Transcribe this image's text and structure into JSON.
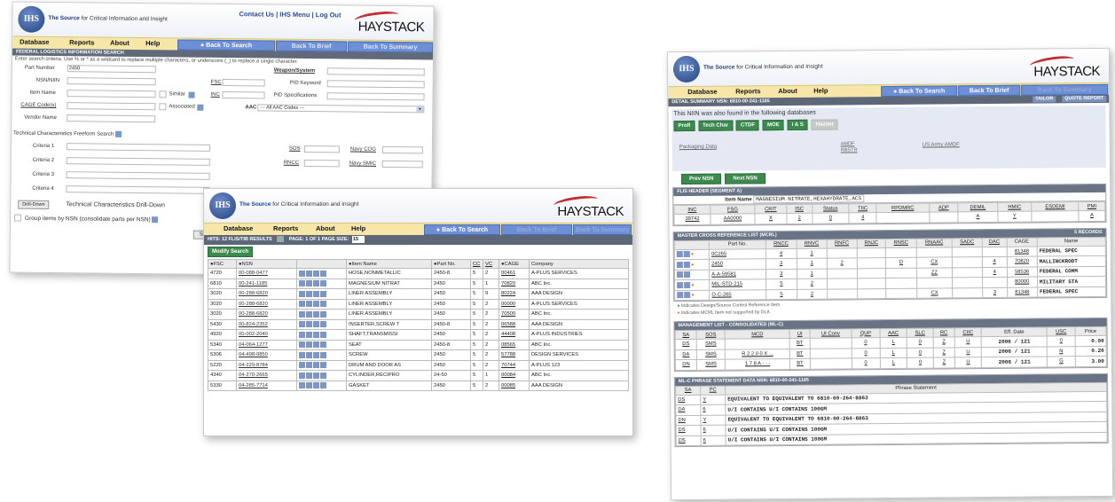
{
  "common": {
    "logo": "IHS",
    "tagline_bold": "The Source",
    "tagline": "for Critical Information and Insight",
    "brand": "HAYSTACK",
    "menu": [
      "Database",
      "Reports",
      "About",
      "Help"
    ],
    "btn_search": "Back To Search",
    "btn_brief": "Back To Brief",
    "btn_summary": "Back To Summary"
  },
  "win1": {
    "links": "Contact Us | IHS Menu | Log Out",
    "section_title": "FEDERAL LOGISTICS INFORMATION SEARCH",
    "instructions": "Enter search criteria. Use % or * as a wildcard to replace multiple characters, or underscore (_) to replace a single character.",
    "part_number_label": "Part Number",
    "part_number_value": "2450",
    "nsn_label": "NSN/NIIN",
    "item_name_label": "Item Name",
    "cage_label": "CAGE Code(s)",
    "vendor_label": "Vendor Name",
    "weapon_label": "Weapon/System",
    "fsc_label": "FSC",
    "inc_label": "INC",
    "similar_label": "Similar",
    "associated_label": "Associated",
    "pid_kw_label": "PID Keyword",
    "pid_spec_label": "PID Specifications",
    "aac_label": "AAC",
    "aac_value": "--- All AAC Codes ---",
    "tech_title": "Technical Characteristics Freeform Search",
    "criteria": [
      "Criteria 1",
      "Criteria 2",
      "Criteria 3",
      "Criteria 4"
    ],
    "sos_label": "SOS",
    "rncc_label": "RNCC",
    "navy_cog_label": "Navy COG",
    "navy_smic_label": "Navy SMIC",
    "drill_btn": "Drill-Down",
    "drill_label": "Technical Characteristics Drill-Down",
    "group_label": "Group items by NSN (consolidate parts per NSN)",
    "search_btn": "Sea"
  },
  "win2": {
    "hits": "HITS: 12  FLIS/TIB RESULTS",
    "page": "PAGE: 1 OF 1   PAGE SIZE:",
    "page_size": "15",
    "modify_btn": "Modify Search",
    "columns": [
      "FSC",
      "NSN",
      "",
      "Item Name",
      "Part No.",
      "CC",
      "VC",
      "CAGE",
      "Company"
    ],
    "rows": [
      [
        "4720",
        "00-088-0477",
        "HOSE,NONMETALLIC",
        "2450-8",
        "5",
        "2",
        "00461",
        "A-PLUS SERVICES"
      ],
      [
        "6810",
        "00-241-1185",
        "MAGNESIUM NITRAT",
        "2450",
        "5",
        "1",
        "70820",
        "ABC Inc."
      ],
      [
        "3020",
        "00-288-6820",
        "LINER ASSEMBLY",
        "2450",
        "5",
        "9",
        "80224",
        "AAA DESIGN"
      ],
      [
        "3020",
        "00-288-6820",
        "LINER ASSEMBLY",
        "2450",
        "5",
        "2",
        "00000",
        "A-PLUS SERVICES"
      ],
      [
        "3020",
        "00-288-6820",
        "LINER ASSEMBLY",
        "2450",
        "5",
        "2",
        "70500",
        "ABC Inc."
      ],
      [
        "5430",
        "00-824-2352",
        "INSERTER,SCREW T",
        "2450-8",
        "5",
        "2",
        "06588",
        "AAA DESIGN"
      ],
      [
        "4920",
        "00-002-2040",
        "SHAFT,TRANSMISSI",
        "2450",
        "5",
        "2",
        "44408",
        "A-PLUS INDUSTRIES"
      ],
      [
        "5340",
        "04-064-1277",
        "SEAT",
        "2450-8",
        "5",
        "2",
        "08565",
        "ABC Inc."
      ],
      [
        "5306",
        "04-498-0850",
        "SCREW",
        "2450",
        "5",
        "2",
        "57788",
        "DESIGN SERVICES"
      ],
      [
        "5220",
        "04-229-8784",
        "DRUM AND DOOR AS",
        "2450",
        "5",
        "2",
        "70744",
        "A-PLUS 123"
      ],
      [
        "4340",
        "04-270-2665",
        "CYLINDER,RECIPRO",
        "24-50",
        "5",
        "1",
        "00084",
        "ABC Inc."
      ],
      [
        "5330",
        "04-285-7714",
        "GASKET",
        "2450",
        "5",
        "2",
        "00085",
        "AAA DESIGN"
      ]
    ]
  },
  "win3": {
    "detail_bar": "DETAIL SUMMARY    NSN: 6810-00-241-1185",
    "tailor_btn": "TAILOR",
    "quote_btn": "QUOTE REPORT",
    "found_text": "This NIIN was also found in the following databases",
    "db_buttons": [
      "Profl",
      "Tech Char",
      "CTDF",
      "MOE",
      "I & S",
      "Haznet"
    ],
    "db_links": [
      "Packaging Data",
      "AMDF",
      "US Army AMDF"
    ],
    "db_links_sub": "RBSTR",
    "prev_btn": "Prev NSN",
    "next_btn": "Next NSN",
    "flis_title": "FLIS HEADER (SEGMENT A)",
    "item_name_label": "Item Name",
    "item_name_value": "MAGNESIUM NITRATE,HEXAHYDRATE,ACS",
    "flis_cols": [
      "INC",
      "FSG",
      "CRIT",
      "ISC",
      "Status",
      "TIIC",
      "RPDMRC",
      "ADP",
      "DEMIL",
      "HMIC",
      "ESDEMI",
      "PMI"
    ],
    "flis_vals": [
      "39742",
      "AA0000",
      "X",
      "2",
      "0",
      "4",
      "",
      "",
      "A",
      "Y",
      "",
      "A"
    ],
    "mcrl_title": "MASTER CROSS REFERENCE LIST (MCRL)",
    "mcrl_count": "5 RECORDS",
    "mcrl_cols": [
      "",
      "Part No.",
      "RNCC",
      "RNVC",
      "RNFC",
      "RNJC",
      "RNSC",
      "RNAAC",
      "SADC",
      "DAC",
      "CAGE",
      "Name"
    ],
    "mcrl_rows": [
      [
        "",
        "0C265",
        "4",
        "1",
        "",
        "",
        "",
        "",
        "",
        "",
        "81348",
        "FEDERAL SPEC"
      ],
      [
        "",
        "2450",
        "3",
        "1",
        "2",
        "",
        "D",
        "CX",
        "",
        "4",
        "70820",
        "MALLINCKRODT"
      ],
      [
        "",
        "A-A-59581",
        "3",
        "1",
        "",
        "",
        "",
        "ZZ",
        "",
        "4",
        "58536",
        "FEDERAL COMM"
      ],
      [
        "",
        "MIL-STD-215",
        "5",
        "2",
        "",
        "",
        "",
        "",
        "",
        "",
        "80000",
        "MILITARY STA"
      ],
      [
        "",
        "O-C-265",
        "5",
        "2",
        "",
        "",
        "",
        "CX",
        "",
        "3",
        "81348",
        "FEDERAL SPEC"
      ]
    ],
    "note1": "Indicates Design/Source Control Reference Item",
    "note2": "Indicates MCRL Item not supported by DLA",
    "ml_title": "MANAGEMENT LIST - CONSOLIDATED (ML-C)",
    "ml_cols": [
      "SA",
      "SOS",
      "MCD",
      "UI",
      "UI Conv",
      "QUP",
      "AAC",
      "SLC",
      "RC",
      "CIIC",
      "Eff. Date",
      "USC",
      "Price"
    ],
    "ml_rows": [
      [
        "DS",
        "SMS",
        "",
        "BT",
        "",
        "0",
        "L",
        "0",
        "Z",
        "U",
        "2006 / 121",
        "0",
        "0.00"
      ],
      [
        "DA",
        "SMS",
        "R 2 2 0 0 X ...",
        "BT",
        "",
        "0",
        "L",
        "0",
        "Z",
        "U",
        "2006 / 121",
        "N",
        "0.26"
      ],
      [
        "DN",
        "SMS",
        "1 7 8 A - - -",
        "BT",
        "",
        "0",
        "L",
        "0",
        "Z",
        "U",
        "2006 / 121",
        "G",
        "3.00"
      ]
    ],
    "phrase_title": "ML-C PHRASE STATEMENT DATA     NSN: 6810-00-241-1185",
    "phrase_cols": [
      "SA",
      "PC",
      "Phrase Statement"
    ],
    "phrase_rows": [
      [
        "DS",
        "Y",
        "EQUIVALENT TO EQUIVALENT TO 6810-00-264-8863"
      ],
      [
        "DA",
        "6",
        "U/I CONTAINS U/I CONTAINS 100GM"
      ],
      [
        "DN",
        "Y",
        "EQUIVALENT TO EQUIVALENT TO 6810-00-264-8863"
      ],
      [
        "DS",
        "6",
        "U/I CONTAINS U/I CONTAINS 100GM"
      ],
      [
        "DS",
        "6",
        "U/I CONTAINS U/I CONTAINS 100GM"
      ]
    ]
  }
}
